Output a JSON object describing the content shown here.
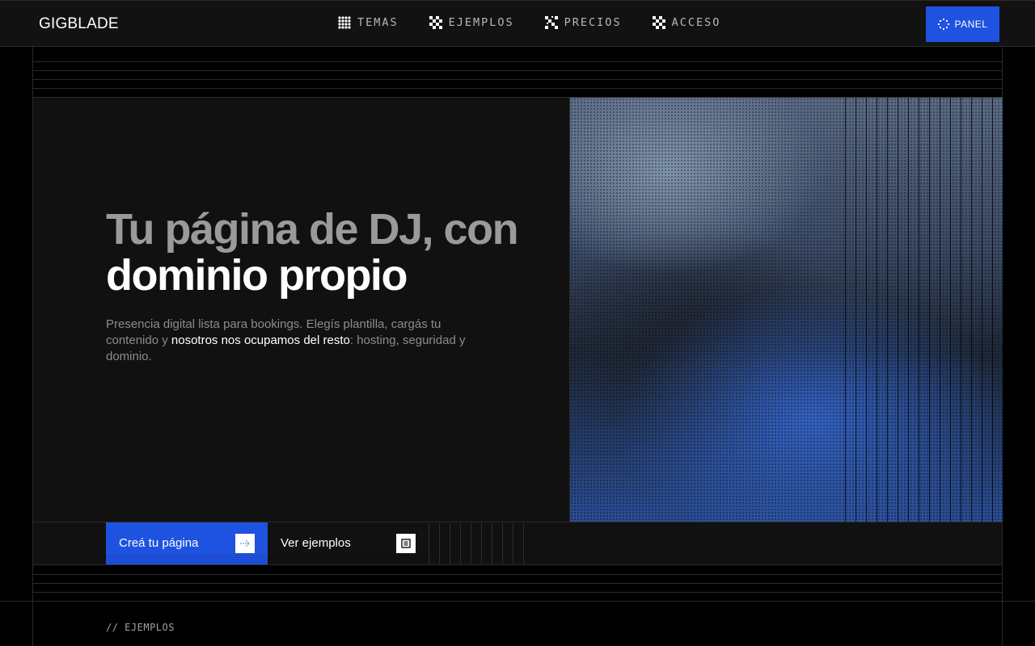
{
  "brand": {
    "name": "GIGBLADE"
  },
  "nav": {
    "items": [
      {
        "label": "TEMAS",
        "icon": "grid-dots-icon"
      },
      {
        "label": "EJEMPLOS",
        "icon": "checker-icon"
      },
      {
        "label": "PRECIOS",
        "icon": "checker-icon"
      },
      {
        "label": "ACCESO",
        "icon": "checker-icon"
      }
    ],
    "panel_label": "PANEL",
    "panel_icon": "dotted-circle-icon"
  },
  "hero": {
    "title_line1": "Tu página de DJ, con",
    "title_line2": "dominio propio",
    "subtitle_part1": "Presencia digital lista para bookings. Elegís plantilla, cargás tu contenido y ",
    "subtitle_strong": "nosotros nos ocupamos del resto",
    "subtitle_part2": ": hosting, seguridad y dominio."
  },
  "cta": {
    "primary_label": "Creá tu página",
    "primary_icon": "arrow-right-icon",
    "secondary_label": "Ver ejemplos",
    "secondary_icon": "list-box-icon"
  },
  "section": {
    "label": "// EJEMPLOS"
  },
  "colors": {
    "accent": "#1e52e0",
    "background": "#000000",
    "panel": "#111111",
    "border": "#2a2a2a"
  }
}
